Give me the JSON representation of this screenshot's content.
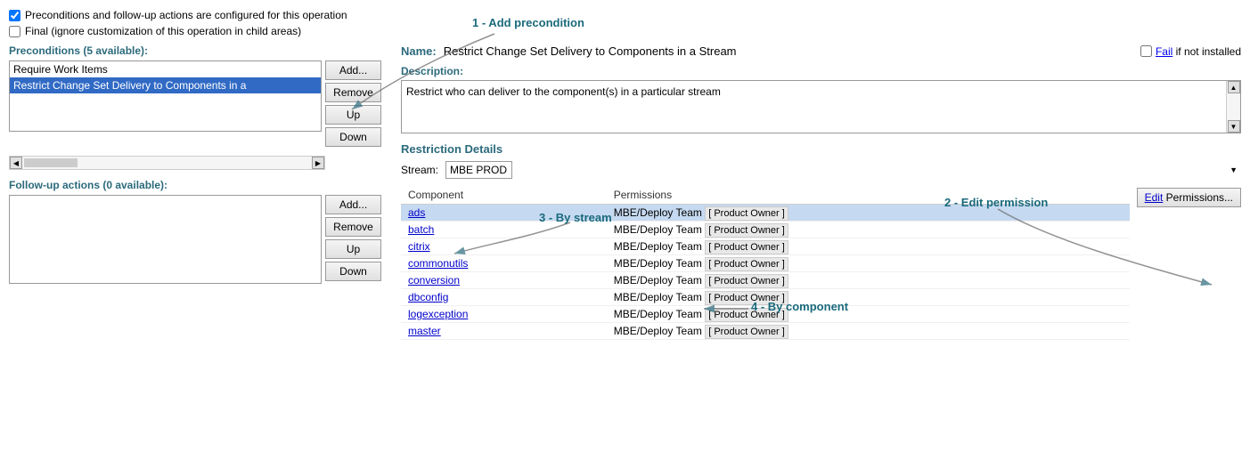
{
  "checkboxes": {
    "preconditions_label": "Preconditions and follow-up actions are configured for this operation",
    "preconditions_checked": true,
    "final_label": "Final (ignore customization of this operation in child areas)",
    "final_checked": false
  },
  "left": {
    "preconditions_title": "Preconditions (5 available):",
    "preconditions_items": [
      {
        "label": "Require Work Items",
        "selected": false
      },
      {
        "label": "Restrict Change Set Delivery to Components in a",
        "selected": true
      }
    ],
    "buttons": {
      "add": "Add...",
      "remove": "Remove",
      "up": "Up",
      "down": "Down"
    },
    "followup_title": "Follow-up actions (0 available):",
    "followup_buttons": {
      "add": "Add...",
      "remove": "Remove",
      "up": "Up",
      "down": "Down"
    }
  },
  "right": {
    "name_label": "Name:",
    "name_value": "Restrict Change Set Delivery to Components in a Stream",
    "fail_label": "Fail if not installed",
    "description_label": "Description:",
    "description_value": "Restrict who can deliver to the component(s) in a particular stream",
    "restriction_title": "Restriction Details",
    "stream_label": "Stream:",
    "stream_value": "MBE PROD",
    "columns": [
      "Component",
      "Permissions"
    ],
    "components": [
      {
        "name": "ads",
        "permissions": "MBE/Deploy Team",
        "tag": "Product Owner",
        "selected": true
      },
      {
        "name": "batch",
        "permissions": "MBE/Deploy Team",
        "tag": "Product Owner",
        "selected": false
      },
      {
        "name": "citrix",
        "permissions": "MBE/Deploy Team",
        "tag": "Product Owner",
        "selected": false
      },
      {
        "name": "commonutils",
        "permissions": "MBE/Deploy Team",
        "tag": "Product Owner",
        "selected": false
      },
      {
        "name": "conversion",
        "permissions": "MBE/Deploy Team",
        "tag": "Product Owner",
        "selected": false
      },
      {
        "name": "dbconfig",
        "permissions": "MBE/Deploy Team",
        "tag": "Product Owner",
        "selected": false
      },
      {
        "name": "logexception",
        "permissions": "MBE/Deploy Team",
        "tag": "Product Owner",
        "selected": false
      },
      {
        "name": "master",
        "permissions": "MBE/Deploy Team",
        "tag": "Product Owner",
        "selected": false
      }
    ],
    "edit_btn_label": "Edit",
    "edit_btn_suffix": "Permissions..."
  },
  "annotations": {
    "add_precondition": "1 - Add precondition",
    "edit_permission": "2 - Edit permission",
    "by_stream": "3 - By stream",
    "by_component": "4 - By component"
  }
}
